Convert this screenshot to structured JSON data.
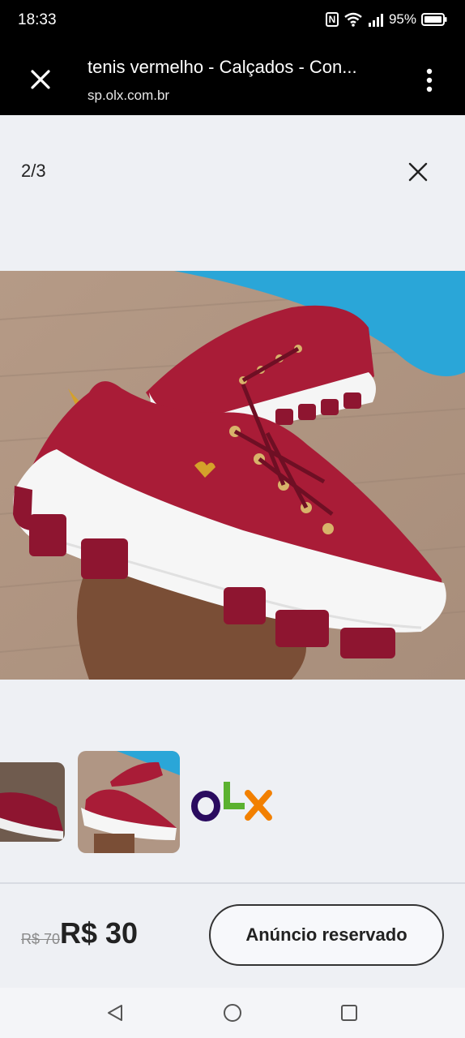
{
  "status": {
    "time": "18:33",
    "battery": "95%"
  },
  "header": {
    "title": "tenis vermelho - Calçados - Con...",
    "url": "sp.olx.com.br"
  },
  "gallery": {
    "counter": "2/3"
  },
  "pricing": {
    "old_price": "R$ 70",
    "price": "R$ 30",
    "action_label": "Anúncio reservado"
  },
  "brand": {
    "logo": "OLX"
  },
  "colors": {
    "shoe": "#a91c37",
    "olx_purple": "#2a0b5f",
    "olx_green": "#5bb12f",
    "olx_orange": "#f28000"
  }
}
